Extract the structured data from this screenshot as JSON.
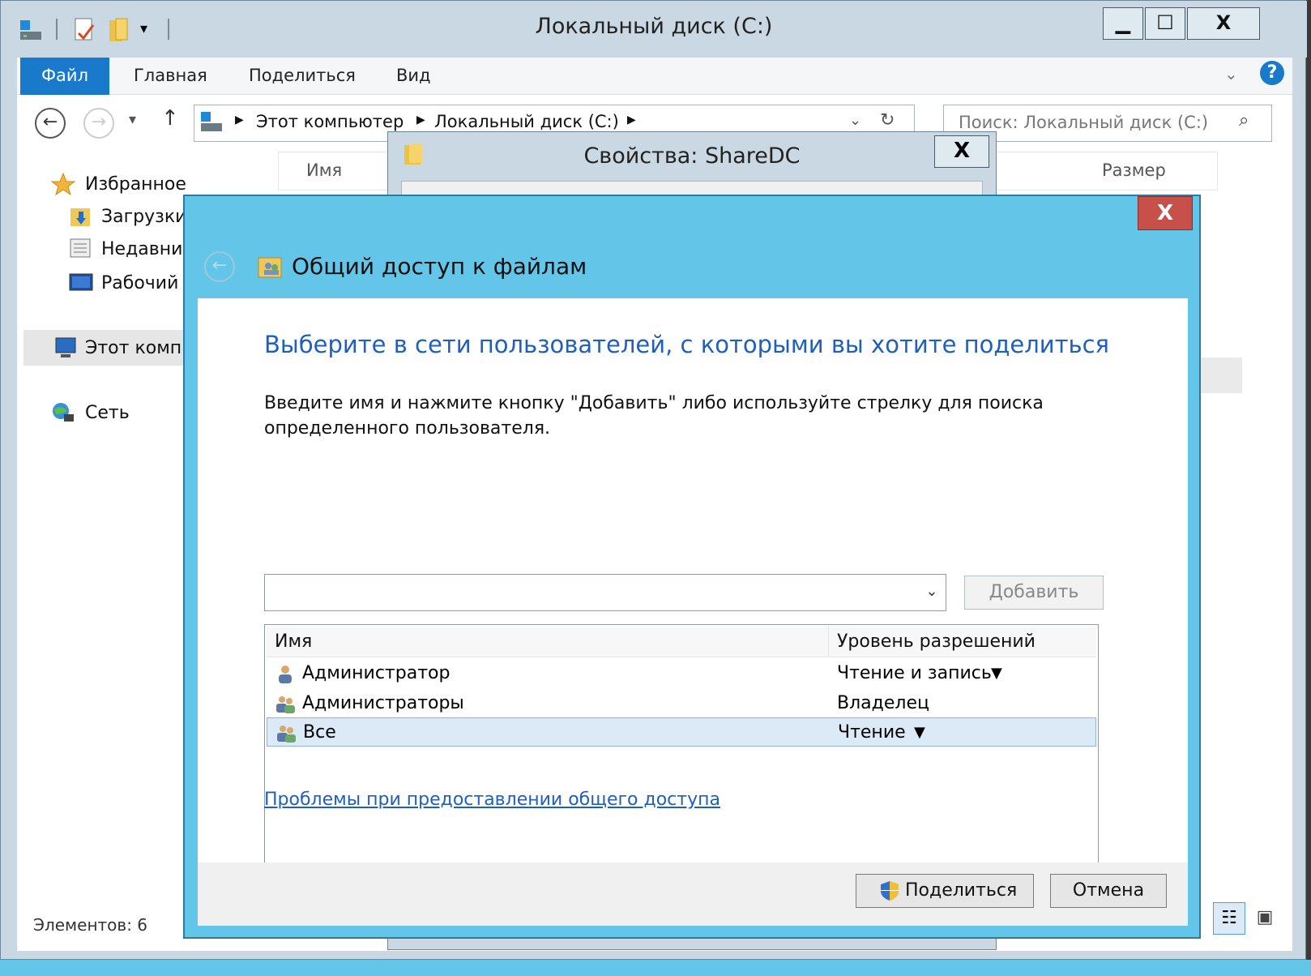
{
  "explorer": {
    "title": "Локальный диск (C:)",
    "ribbon_tabs": {
      "file": "Файл",
      "home": "Главная",
      "share": "Поделиться",
      "view": "Вид"
    },
    "address": {
      "seg1": "Этот компьютер",
      "seg2": "Локальный диск (C:)"
    },
    "search_placeholder": "Поиск: Локальный диск (C:)",
    "column_name": "Имя",
    "column_size": "Размер",
    "sidebar": {
      "favorites": "Избранное",
      "downloads": "Загрузки",
      "recent": "Недавние",
      "desktop": "Рабочий",
      "this_pc": "Этот компь",
      "network": "Сеть"
    },
    "status": "Элементов: 6",
    "window_buttons": {
      "minimize": "▁",
      "maximize": "☐",
      "close": "X"
    }
  },
  "properties_dialog": {
    "title": "Свойства: ShareDC",
    "close": "X"
  },
  "share_dialog": {
    "close": "X",
    "title": "Общий доступ к файлам",
    "heading": "Выберите в сети пользователей, с которыми вы хотите поделиться",
    "instruction": "Введите имя и нажмите кнопку \"Добавить\" либо используйте стрелку для поиска определенного пользователя.",
    "add_button": "Добавить",
    "table": {
      "col_name": "Имя",
      "col_perm": "Уровень разрешений",
      "rows": [
        {
          "name": "Администратор",
          "perm": "Чтение и запись",
          "has_dropdown": true,
          "icon": "user-icon"
        },
        {
          "name": "Администраторы",
          "perm": "Владелец",
          "has_dropdown": false,
          "icon": "group-icon"
        },
        {
          "name": "Все",
          "perm": "Чтение",
          "has_dropdown": true,
          "icon": "group-icon",
          "selected": true
        }
      ]
    },
    "help_link": "Проблемы при предоставлении общего доступа",
    "share_button": "Поделиться",
    "cancel_button": "Отмена"
  },
  "colors": {
    "accent_dialog": "#63c6e8",
    "link_blue": "#1f5fbf",
    "file_tab": "#1979ca",
    "close_red": "#c7504a"
  }
}
